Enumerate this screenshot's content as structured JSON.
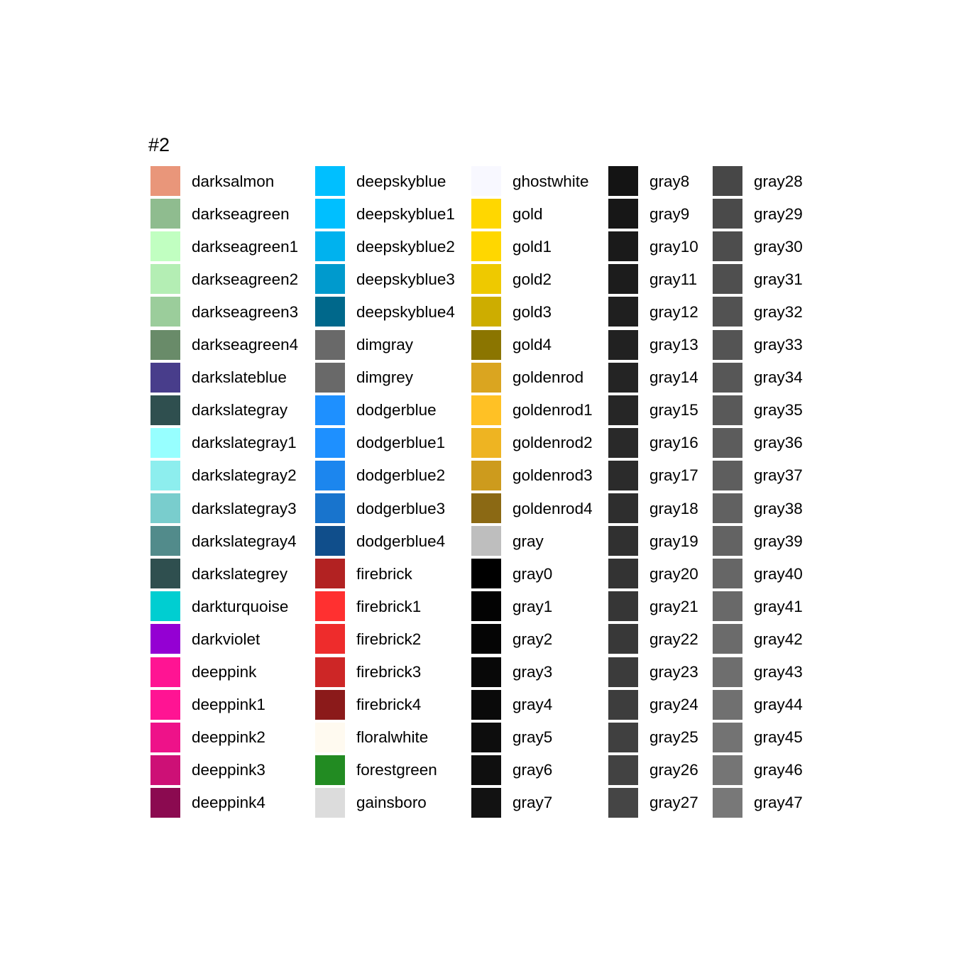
{
  "chart_data": {
    "type": "table",
    "title": "#2",
    "columns": [
      {
        "entries": [
          {
            "name": "darksalmon",
            "color": "#E9967A"
          },
          {
            "name": "darkseagreen",
            "color": "#8FBC8F"
          },
          {
            "name": "darkseagreen1",
            "color": "#C1FFC1"
          },
          {
            "name": "darkseagreen2",
            "color": "#B4EEB4"
          },
          {
            "name": "darkseagreen3",
            "color": "#9BCD9B"
          },
          {
            "name": "darkseagreen4",
            "color": "#698B69"
          },
          {
            "name": "darkslateblue",
            "color": "#483D8B"
          },
          {
            "name": "darkslategray",
            "color": "#2F4F4F"
          },
          {
            "name": "darkslategray1",
            "color": "#97FFFF"
          },
          {
            "name": "darkslategray2",
            "color": "#8DEEEE"
          },
          {
            "name": "darkslategray3",
            "color": "#79CDCD"
          },
          {
            "name": "darkslategray4",
            "color": "#528B8B"
          },
          {
            "name": "darkslategrey",
            "color": "#2F4F4F"
          },
          {
            "name": "darkturquoise",
            "color": "#00CED1"
          },
          {
            "name": "darkviolet",
            "color": "#9400D3"
          },
          {
            "name": "deeppink",
            "color": "#FF1493"
          },
          {
            "name": "deeppink1",
            "color": "#FF1493"
          },
          {
            "name": "deeppink2",
            "color": "#EE1289"
          },
          {
            "name": "deeppink3",
            "color": "#CD1076"
          },
          {
            "name": "deeppink4",
            "color": "#8B0A50"
          }
        ]
      },
      {
        "entries": [
          {
            "name": "deepskyblue",
            "color": "#00BFFF"
          },
          {
            "name": "deepskyblue1",
            "color": "#00BFFF"
          },
          {
            "name": "deepskyblue2",
            "color": "#00B2EE"
          },
          {
            "name": "deepskyblue3",
            "color": "#009ACD"
          },
          {
            "name": "deepskyblue4",
            "color": "#00688B"
          },
          {
            "name": "dimgray",
            "color": "#696969"
          },
          {
            "name": "dimgrey",
            "color": "#696969"
          },
          {
            "name": "dodgerblue",
            "color": "#1E90FF"
          },
          {
            "name": "dodgerblue1",
            "color": "#1E90FF"
          },
          {
            "name": "dodgerblue2",
            "color": "#1C86EE"
          },
          {
            "name": "dodgerblue3",
            "color": "#1874CD"
          },
          {
            "name": "dodgerblue4",
            "color": "#104E8B"
          },
          {
            "name": "firebrick",
            "color": "#B22222"
          },
          {
            "name": "firebrick1",
            "color": "#FF3030"
          },
          {
            "name": "firebrick2",
            "color": "#EE2C2C"
          },
          {
            "name": "firebrick3",
            "color": "#CD2626"
          },
          {
            "name": "firebrick4",
            "color": "#8B1A1A"
          },
          {
            "name": "floralwhite",
            "color": "#FFFAF0"
          },
          {
            "name": "forestgreen",
            "color": "#228B22"
          },
          {
            "name": "gainsboro",
            "color": "#DCDCDC"
          }
        ]
      },
      {
        "entries": [
          {
            "name": "ghostwhite",
            "color": "#F8F8FF"
          },
          {
            "name": "gold",
            "color": "#FFD700"
          },
          {
            "name": "gold1",
            "color": "#FFD700"
          },
          {
            "name": "gold2",
            "color": "#EEC900"
          },
          {
            "name": "gold3",
            "color": "#CDAD00"
          },
          {
            "name": "gold4",
            "color": "#8B7500"
          },
          {
            "name": "goldenrod",
            "color": "#DAA520"
          },
          {
            "name": "goldenrod1",
            "color": "#FFC125"
          },
          {
            "name": "goldenrod2",
            "color": "#EEB422"
          },
          {
            "name": "goldenrod3",
            "color": "#CD9B1D"
          },
          {
            "name": "goldenrod4",
            "color": "#8B6914"
          },
          {
            "name": "gray",
            "color": "#BEBEBE"
          },
          {
            "name": "gray0",
            "color": "#000000"
          },
          {
            "name": "gray1",
            "color": "#030303"
          },
          {
            "name": "gray2",
            "color": "#050505"
          },
          {
            "name": "gray3",
            "color": "#080808"
          },
          {
            "name": "gray4",
            "color": "#0A0A0A"
          },
          {
            "name": "gray5",
            "color": "#0D0D0D"
          },
          {
            "name": "gray6",
            "color": "#0F0F0F"
          },
          {
            "name": "gray7",
            "color": "#121212"
          }
        ]
      },
      {
        "entries": [
          {
            "name": "gray8",
            "color": "#141414"
          },
          {
            "name": "gray9",
            "color": "#171717"
          },
          {
            "name": "gray10",
            "color": "#1A1A1A"
          },
          {
            "name": "gray11",
            "color": "#1C1C1C"
          },
          {
            "name": "gray12",
            "color": "#1F1F1F"
          },
          {
            "name": "gray13",
            "color": "#212121"
          },
          {
            "name": "gray14",
            "color": "#242424"
          },
          {
            "name": "gray15",
            "color": "#262626"
          },
          {
            "name": "gray16",
            "color": "#292929"
          },
          {
            "name": "gray17",
            "color": "#2B2B2B"
          },
          {
            "name": "gray18",
            "color": "#2E2E2E"
          },
          {
            "name": "gray19",
            "color": "#303030"
          },
          {
            "name": "gray20",
            "color": "#333333"
          },
          {
            "name": "gray21",
            "color": "#363636"
          },
          {
            "name": "gray22",
            "color": "#383838"
          },
          {
            "name": "gray23",
            "color": "#3B3B3B"
          },
          {
            "name": "gray24",
            "color": "#3D3D3D"
          },
          {
            "name": "gray25",
            "color": "#404040"
          },
          {
            "name": "gray26",
            "color": "#424242"
          },
          {
            "name": "gray27",
            "color": "#454545"
          }
        ]
      },
      {
        "entries": [
          {
            "name": "gray28",
            "color": "#474747"
          },
          {
            "name": "gray29",
            "color": "#4A4A4A"
          },
          {
            "name": "gray30",
            "color": "#4D4D4D"
          },
          {
            "name": "gray31",
            "color": "#4F4F4F"
          },
          {
            "name": "gray32",
            "color": "#525252"
          },
          {
            "name": "gray33",
            "color": "#545454"
          },
          {
            "name": "gray34",
            "color": "#575757"
          },
          {
            "name": "gray35",
            "color": "#595959"
          },
          {
            "name": "gray36",
            "color": "#5C5C5C"
          },
          {
            "name": "gray37",
            "color": "#5E5E5E"
          },
          {
            "name": "gray38",
            "color": "#616161"
          },
          {
            "name": "gray39",
            "color": "#636363"
          },
          {
            "name": "gray40",
            "color": "#666666"
          },
          {
            "name": "gray41",
            "color": "#696969"
          },
          {
            "name": "gray42",
            "color": "#6B6B6B"
          },
          {
            "name": "gray43",
            "color": "#6E6E6E"
          },
          {
            "name": "gray44",
            "color": "#707070"
          },
          {
            "name": "gray45",
            "color": "#737373"
          },
          {
            "name": "gray46",
            "color": "#757575"
          },
          {
            "name": "gray47",
            "color": "#787878"
          }
        ]
      }
    ]
  }
}
